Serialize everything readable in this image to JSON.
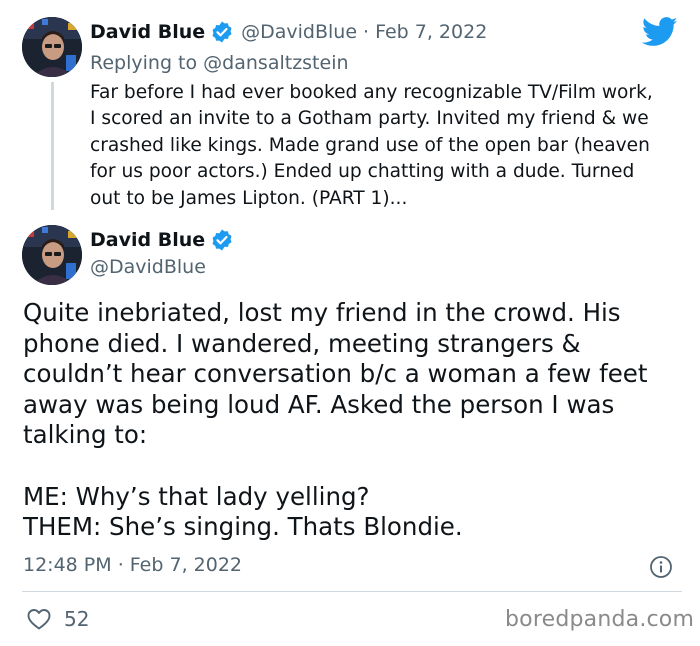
{
  "reply_tweet": {
    "display_name": "David Blue",
    "handle": "@DavidBlue",
    "separator": "·",
    "date": "Feb 7, 2022",
    "replying_prefix": "Replying to",
    "replying_to": "@dansaltzstein",
    "text": "Far before I had ever booked any recognizable TV/Film work,\nI scored an invite to a Gotham party. Invited my friend & we\ncrashed like kings. Made grand use of the open bar (heaven\nfor us poor actors.) Ended up chatting with a dude. Turned\nout to be James Lipton. (PART 1)..."
  },
  "main_tweet": {
    "display_name": "David Blue",
    "handle": "@DavidBlue",
    "paragraph_1": "Quite inebriated, lost my friend in the crowd. His phone died. I wandered, meeting strangers & couldn’t hear conversation b/c a woman a few feet away was being loud AF. Asked the person I was talking to:",
    "line_me": "ME: Why’s that lady yelling?",
    "line_them": "THEM: She’s singing. Thats Blondie.",
    "time": "12:48 PM",
    "separator": "·",
    "date": "Feb 7, 2022",
    "likes": "52"
  },
  "icons": {
    "verified": "verified-badge-icon",
    "brand": "twitter-bird-icon",
    "info": "info-icon",
    "like": "heart-icon"
  },
  "colors": {
    "twitter_blue": "#1d9bf0",
    "text_primary": "#0f1419",
    "text_secondary": "#536471",
    "thread_line": "#cfd9de"
  },
  "watermark": "boredpanda.com"
}
